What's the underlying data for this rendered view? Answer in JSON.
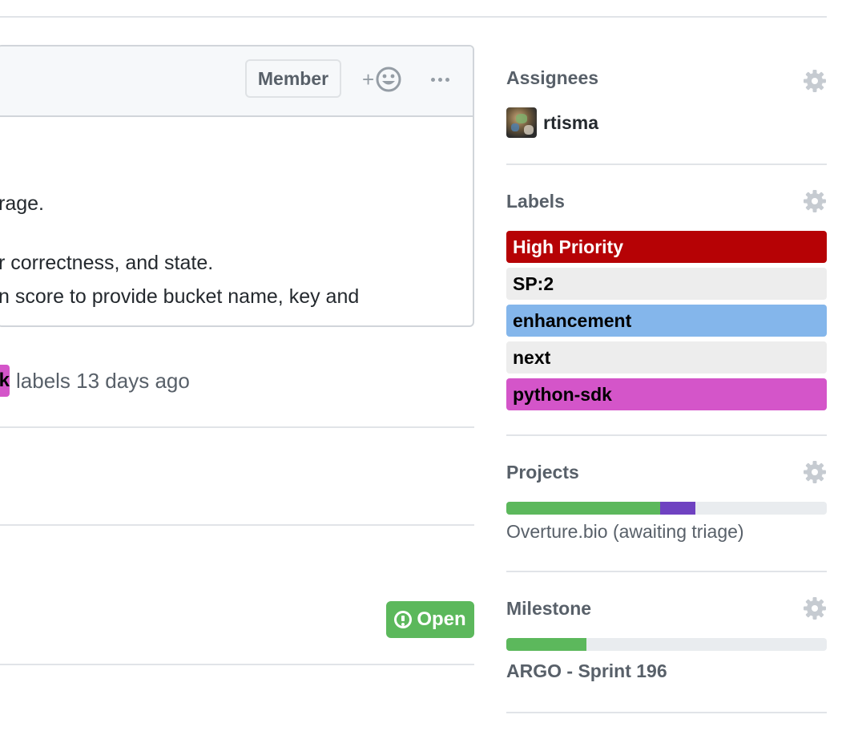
{
  "comment": {
    "badge": "Member",
    "react_plus": "+",
    "body_lines": [
      "rage.",
      "r correctness, and state.",
      "n score to provide bucket name, key and"
    ]
  },
  "label_event": {
    "partial_chip": "k",
    "text": "labels 13 days ago"
  },
  "status": {
    "label": "Open"
  },
  "sidebar": {
    "assignees": {
      "heading": "Assignees",
      "users": [
        "rtisma"
      ]
    },
    "labels": {
      "heading": "Labels",
      "items": [
        {
          "name": "High Priority",
          "bg": "#b60205",
          "fg": "#ffffff"
        },
        {
          "name": "SP:2",
          "bg": "#ededed",
          "fg": "#000000"
        },
        {
          "name": "enhancement",
          "bg": "#84b6eb",
          "fg": "#000000"
        },
        {
          "name": "next",
          "bg": "#ededed",
          "fg": "#000000"
        },
        {
          "name": "python-sdk",
          "bg": "#d455c9",
          "fg": "#000000"
        }
      ]
    },
    "projects": {
      "heading": "Projects",
      "name": "Overture.bio (awaiting triage)",
      "progress": {
        "done": 0.48,
        "in_progress": 0.11
      }
    },
    "milestone": {
      "heading": "Milestone",
      "name": "ARGO - Sprint 196",
      "progress": 0.25
    }
  },
  "colors": {
    "progress_done": "#5cb85c",
    "progress_in_progress": "#6f42c1",
    "open_badge": "#5cb85c",
    "gear": "#c6cbd1"
  }
}
